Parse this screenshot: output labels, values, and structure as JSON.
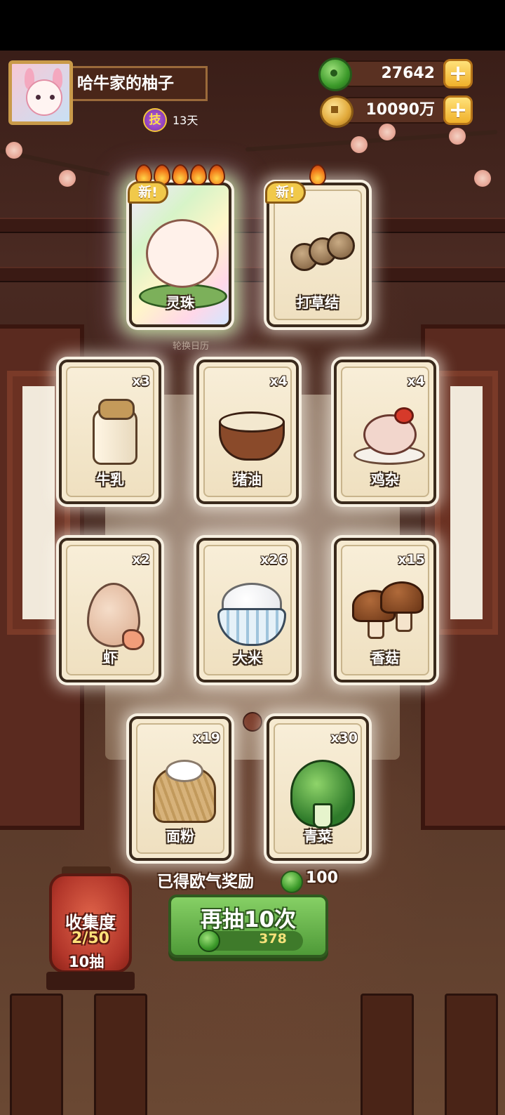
{
  "profile": {
    "name": "哈牛家的柚子",
    "skill_badge": "技",
    "skill_days": "13天"
  },
  "currency": {
    "jade": {
      "value": "27642",
      "plus": "+"
    },
    "coins": {
      "value": "10090万",
      "plus": "+"
    }
  },
  "featured_cards": [
    {
      "name": "灵珠",
      "tag": "新!",
      "flames": 5,
      "rarity": "rainbow"
    },
    {
      "name": "打草结",
      "tag": "新!",
      "flames": 1,
      "rarity": "normal"
    }
  ],
  "flame_label": "轮换日历",
  "cards": [
    {
      "name": "牛乳",
      "count": "x3"
    },
    {
      "name": "猪油",
      "count": "x4"
    },
    {
      "name": "鸡杂",
      "count": "x4"
    },
    {
      "name": "虾",
      "count": "x2"
    },
    {
      "name": "大米",
      "count": "x26"
    },
    {
      "name": "香菇",
      "count": "x15"
    },
    {
      "name": "面粉",
      "count": "x19"
    },
    {
      "name": "青菜",
      "count": "x30"
    }
  ],
  "reward": {
    "label": "已得欧气奖励",
    "value": "100"
  },
  "draw_button": {
    "label": "再抽10次",
    "cost": "378"
  },
  "collection": {
    "title": "收集度",
    "progress": "2/50",
    "draws": "10抽"
  }
}
